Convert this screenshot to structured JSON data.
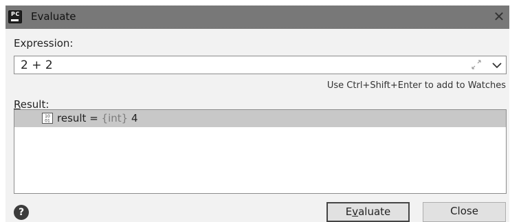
{
  "window": {
    "title": "Evaluate",
    "app_icon": {
      "name": "pycharm-icon",
      "text": "PC"
    },
    "close_glyph": "✕"
  },
  "expression": {
    "label": "Expression:",
    "value": "2 + 2",
    "expand_icon": "expand-icon",
    "history_icon": "chevron-down-icon"
  },
  "hint": "Use Ctrl+Shift+Enter to add to Watches",
  "result": {
    "label_mnemonic": "R",
    "label_rest": "esult:",
    "row": {
      "icon": "int-variable-icon",
      "icon_text": [
        "10",
        "01"
      ],
      "name_text": "result = ",
      "type_text": "{int}",
      "value_text": " 4"
    }
  },
  "footer": {
    "help_glyph": "?",
    "evaluate_pre": "E",
    "evaluate_mnemonic": "v",
    "evaluate_post": "aluate",
    "close_label": "Close"
  },
  "colors": {
    "titlebar": "#777777",
    "dialog_bg": "#f2f2f2",
    "selected_row": "#c8c8c8",
    "type_text": "#7d7d7d"
  }
}
